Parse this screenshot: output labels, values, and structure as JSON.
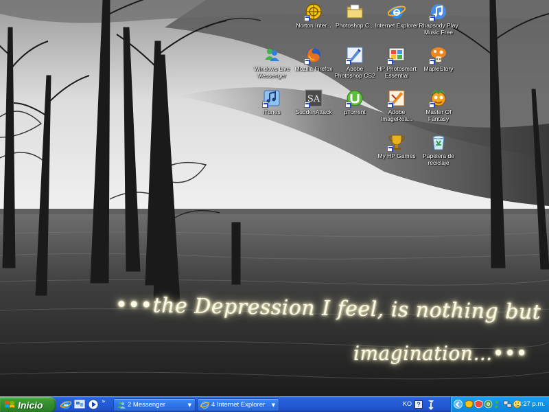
{
  "desktop": {
    "icons": [
      {
        "label": "Norton Inter...",
        "icon": "norton-icon"
      },
      {
        "label": "Photoshop.C...",
        "icon": "folder-icon"
      },
      {
        "label": "Internet Explorer",
        "icon": "internet-explorer-icon"
      },
      {
        "label": "Rhapsody Play Music Free",
        "icon": "rhapsody-icon"
      },
      {
        "label": "Windows Live Messenger",
        "icon": "messenger-icon"
      },
      {
        "label": "Mozilla Firefox",
        "icon": "firefox-icon"
      },
      {
        "label": "Adobe Photoshop CS2",
        "icon": "photoshop-icon"
      },
      {
        "label": "HP Photosmart Essential",
        "icon": "hp-photosmart-icon"
      },
      {
        "label": "MapleStory",
        "icon": "maplestory-icon"
      },
      {
        "label": "iTunes",
        "icon": "itunes-icon"
      },
      {
        "label": "SuddenAttack",
        "icon": "suddenattack-icon",
        "glyph": "SA"
      },
      {
        "label": "µTorrent",
        "icon": "utorrent-icon"
      },
      {
        "label": "Adobe ImageRea...",
        "icon": "imageready-icon"
      },
      {
        "label": "Master Of Fantasy",
        "icon": "master-of-fantasy-icon"
      },
      {
        "label": "My HP Games",
        "icon": "hp-games-icon"
      },
      {
        "label": "Papelera de reciclaje",
        "icon": "recycle-bin-icon"
      }
    ]
  },
  "wallpaper": {
    "line1": "•••the Depression I feel, is nothing but",
    "line2": "imagination…•••"
  },
  "taskbar": {
    "start_label": "Inicio",
    "quick_launch_chevron": "»",
    "tasks": [
      {
        "label": "2 Messenger",
        "icon": "messenger-icon"
      },
      {
        "label": "4 Internet Explorer",
        "icon": "internet-explorer-icon"
      }
    ],
    "language": "KO",
    "help_glyph": "?",
    "clock": "04:27 p.m."
  },
  "colors": {
    "taskbar_blue": "#245ad6",
    "start_green": "#2f8a2a",
    "tray_blue": "#0f93e8"
  }
}
